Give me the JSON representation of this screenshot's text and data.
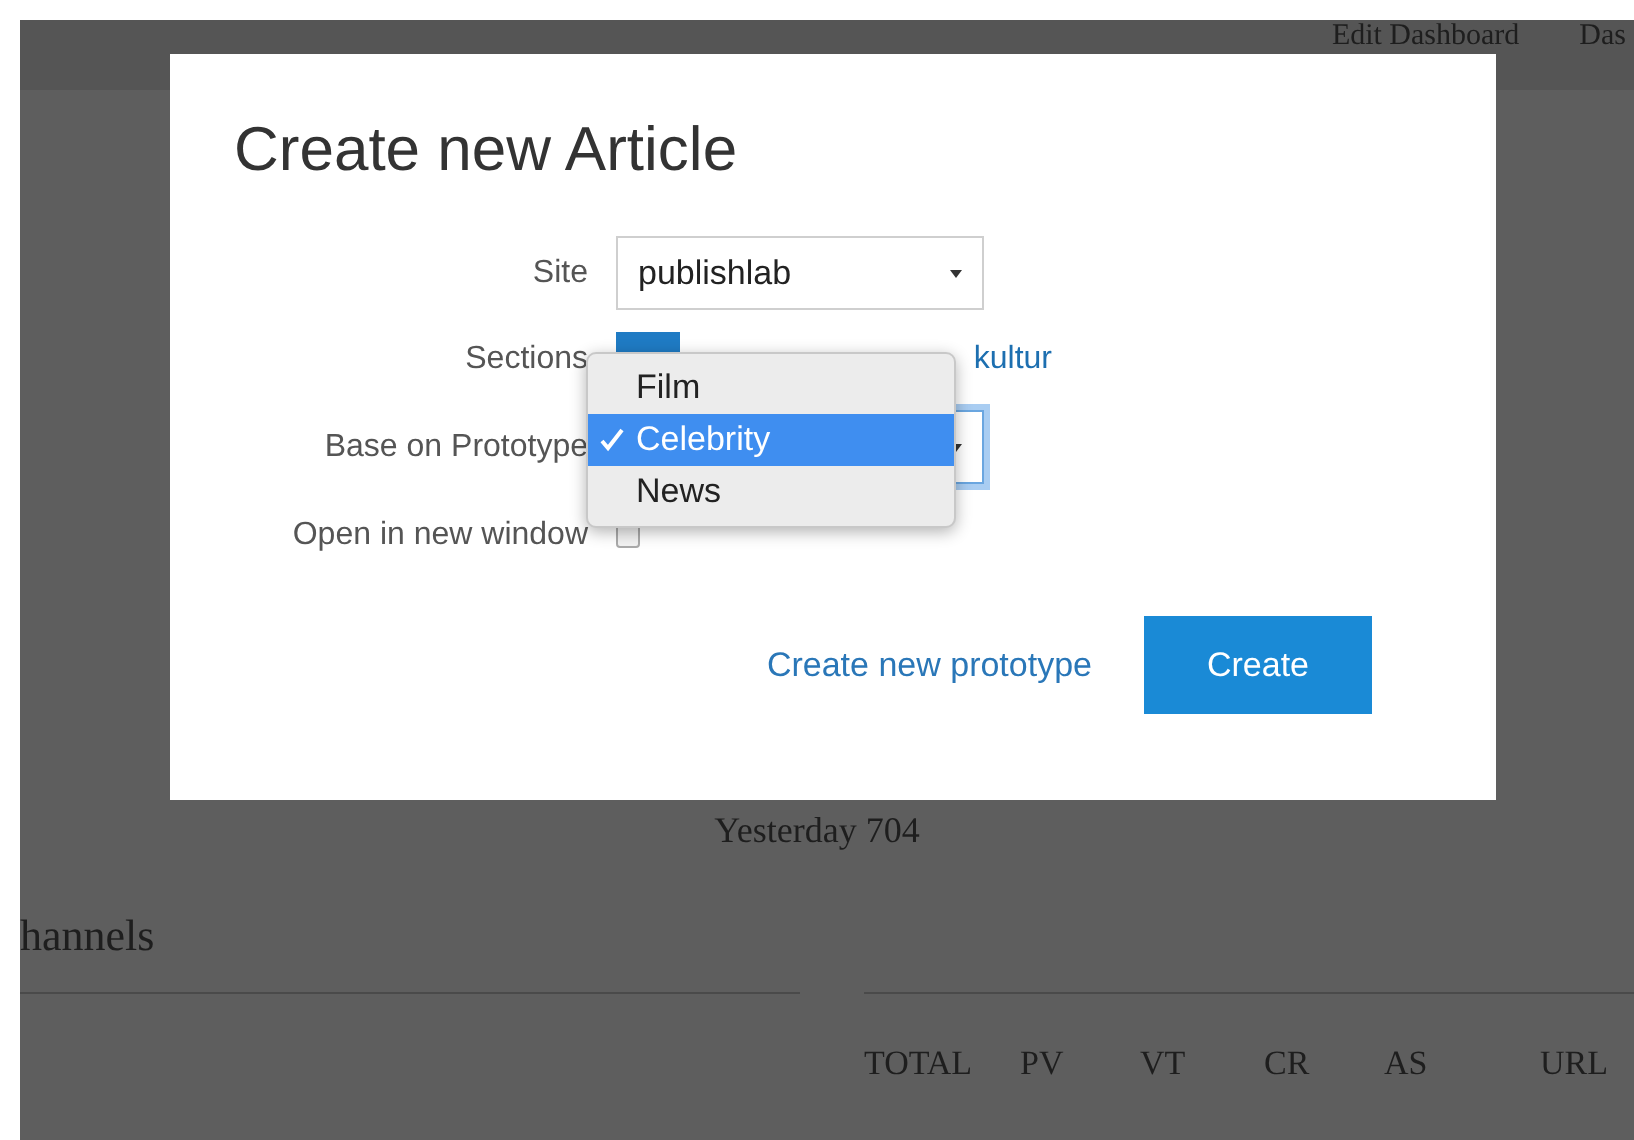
{
  "header": {
    "nav": [
      "Edit Dashboard",
      "Das"
    ]
  },
  "summary": "Yesterday 704",
  "channels_heading": "hannels",
  "table": {
    "columns": [
      "TOTAL",
      "PV",
      "VT",
      "CR",
      "AS",
      "URL"
    ]
  },
  "dialog": {
    "title": "Create new Article",
    "fields": [
      {
        "kind": "select",
        "label": "Site",
        "value": "publishlab"
      },
      {
        "kind": "sections",
        "label": "Sections",
        "link": "kultur"
      },
      {
        "kind": "select",
        "label": "Base on Prototype",
        "focused": true
      },
      {
        "kind": "checkbox",
        "label": "Open in new window",
        "checked": false
      }
    ],
    "dropdown": {
      "options": [
        {
          "label": "Film",
          "selected": false
        },
        {
          "label": "Celebrity",
          "selected": true
        },
        {
          "label": "News",
          "selected": false
        }
      ]
    },
    "link": "Create new prototype",
    "button": "Create"
  }
}
